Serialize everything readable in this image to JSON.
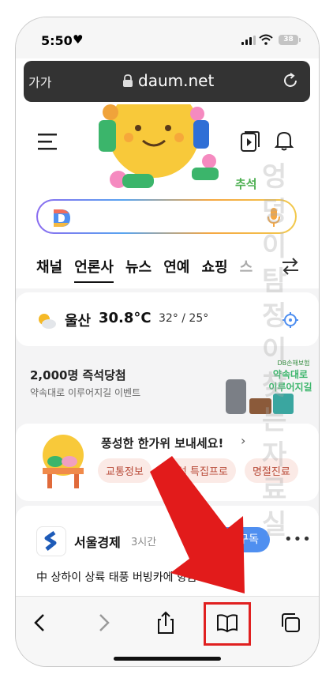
{
  "status_bar": {
    "time": "5:50",
    "battery": "38"
  },
  "browser": {
    "text_size_label": "가가",
    "domain": "daum.net"
  },
  "header": {
    "holiday_label": "추석"
  },
  "tabs": [
    "채널",
    "언론사",
    "뉴스",
    "연예",
    "쇼핑",
    "스"
  ],
  "active_tab_index": 1,
  "weather": {
    "city": "울산",
    "temperature": "30.8°C",
    "range": "32° / 25°"
  },
  "promo": {
    "title": "2,000명 즉석당첨",
    "subtitle": "약속대로 이루어지길 이벤트",
    "ad_brand": "DB손해보험",
    "ad_tagline_1": "약속대로",
    "ad_tagline_2": "이루어지길"
  },
  "festival": {
    "title": "풍성한 한가위 보내세요!",
    "chips": [
      "교통정보",
      "추석 특집프로",
      "명절진료"
    ]
  },
  "news": {
    "publisher": "서울경제",
    "time": "3시간",
    "subscribe_label": "+ 구독",
    "headline": "中 상하이 상륙 태풍 버빙카에 항금 연휴 꼬..."
  },
  "watermark": "엉덩이탐정이찾는자료실",
  "colors": {
    "accent_blue": "#4f8ff0",
    "highlight_red": "#e02020",
    "url_bar": "#333333"
  }
}
